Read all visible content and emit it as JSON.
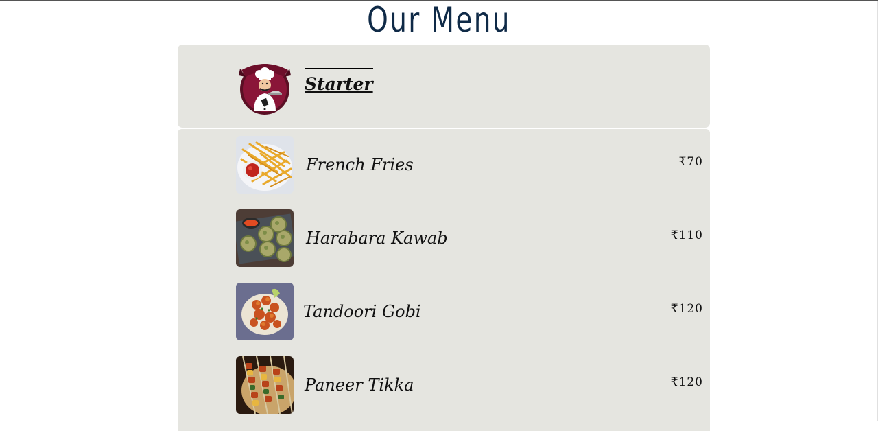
{
  "page": {
    "title": "Our Menu"
  },
  "category": {
    "title": "Starter",
    "logo_icon": "chef-icon"
  },
  "items": [
    {
      "name": "French  Fries",
      "price": "₹70",
      "image_icon": "french-fries-photo"
    },
    {
      "name": "Harabara Kawab",
      "price": "₹110",
      "image_icon": "harabara-kawab-photo"
    },
    {
      "name": "Tandoori Gobi",
      "price": "₹120",
      "image_icon": "tandoori-gobi-photo"
    },
    {
      "name": "Paneer Tikka",
      "price": "₹120",
      "image_icon": "paneer-tikka-photo"
    }
  ],
  "colors": {
    "title": "#0f2a47",
    "panel": "#e5e5e0",
    "logo_maroon": "#8a1538"
  }
}
